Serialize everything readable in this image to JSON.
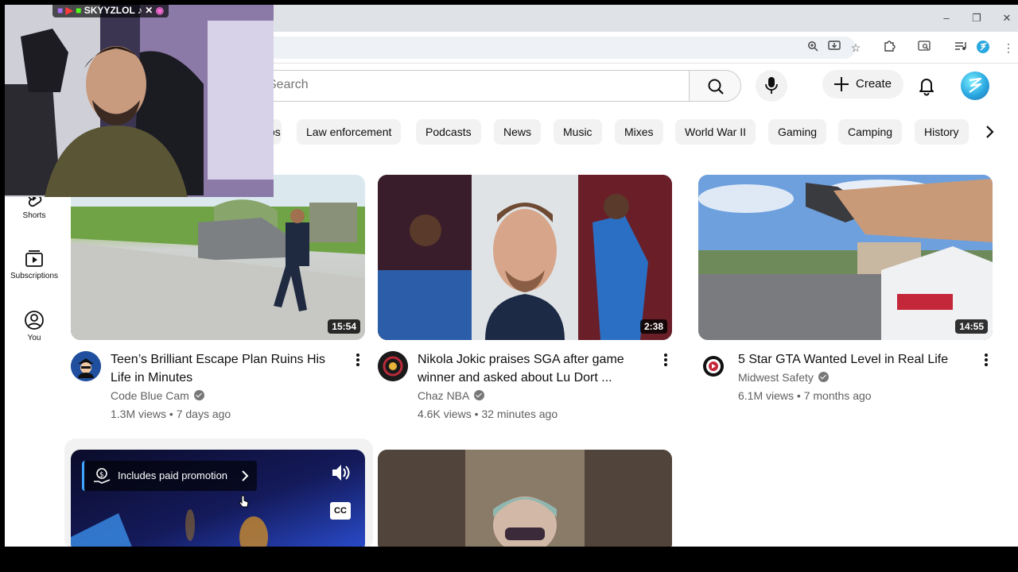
{
  "search": {
    "placeholder": "Search"
  },
  "masthead": {
    "create_label": "Create"
  },
  "chips": [
    "os",
    "Law enforcement",
    "Podcasts",
    "News",
    "Music",
    "Mixes",
    "World War II",
    "Gaming",
    "Camping",
    "History"
  ],
  "nav": [
    {
      "label": "Shorts",
      "icon": "shorts-icon"
    },
    {
      "label": "Subscriptions",
      "icon": "subscriptions-icon"
    },
    {
      "label": "You",
      "icon": "you-icon"
    }
  ],
  "videos": [
    {
      "title": "Teen’s Brilliant Escape Plan Ruins His Life in Minutes",
      "channel": "Code Blue Cam",
      "views": "1.3M views",
      "age": "7 days ago",
      "duration": "15:54"
    },
    {
      "title": "Nikola Jokic praises SGA after game winner and asked about Lu Dort ...",
      "channel": "Chaz NBA",
      "views": "4.6K views",
      "age": "32 minutes ago",
      "duration": "2:38"
    },
    {
      "title": "5 Star GTA Wanted Level in Real Life",
      "channel": "Midwest Safety",
      "views": "6.1M views",
      "age": "7 months ago",
      "duration": "14:55"
    }
  ],
  "promo": {
    "label": "Includes paid promotion",
    "cc_label": "CC"
  },
  "separator": "•",
  "overlay": {
    "streamer_tag": "SKYYZLOL"
  },
  "colors": {
    "accent_avatar": "#2aa8e0",
    "chip_bg": "#f2f2f2",
    "meta_text": "#606060"
  }
}
